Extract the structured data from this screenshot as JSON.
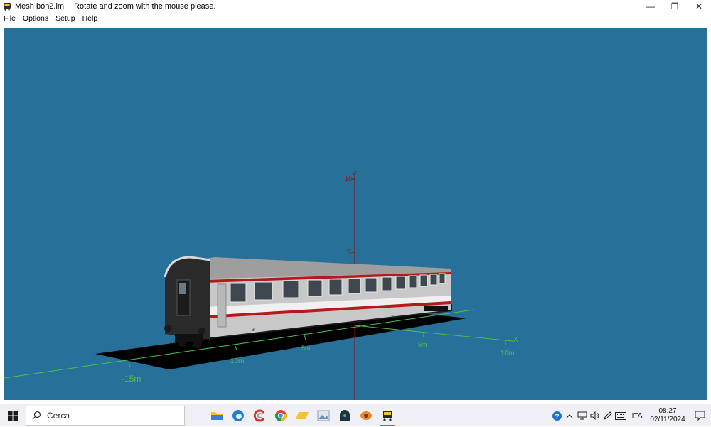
{
  "window": {
    "title": "Mesh bon2.im",
    "hint": "Rotate and zoom with the mouse please.",
    "minimize_glyph": "—",
    "restore_glyph": "❐",
    "close_glyph": "✕"
  },
  "menu": [
    "File",
    "Options",
    "Setup",
    "Help"
  ],
  "scene": {
    "background_color": "#267099",
    "axis_z_label": "Z",
    "axis_x_label": "X",
    "z_ticks": [
      "10",
      "5"
    ],
    "x_ticks": [
      "5m",
      "10m"
    ],
    "y_ticks": [
      "5m",
      "10m",
      "-15m"
    ],
    "car_marking_1": "3",
    "car_marking_2": "2"
  },
  "taskbar": {
    "search_placeholder": "Cerca",
    "apps": [
      "file-explorer",
      "edge",
      "ccleaner",
      "chrome",
      "folder",
      "photos",
      "game-app",
      "eye-app",
      "train-sim"
    ]
  },
  "tray": {
    "language": "ITA",
    "time": "08:27",
    "date": "02/11/2024"
  }
}
